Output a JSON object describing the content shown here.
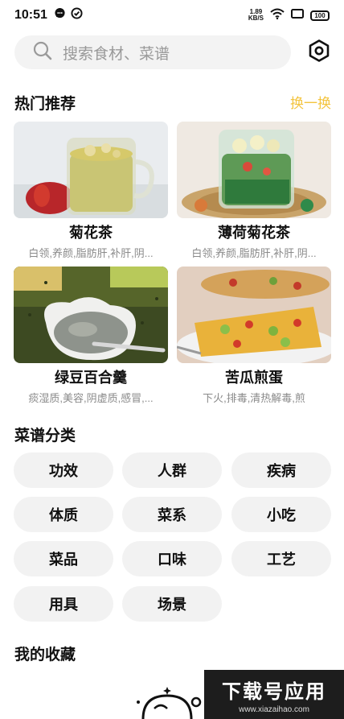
{
  "status_bar": {
    "time": "10:51",
    "net_speed_value": "1.89",
    "net_speed_unit": "KB/S",
    "battery": "100"
  },
  "search": {
    "placeholder": "搜索食材、菜谱"
  },
  "hot": {
    "title": "热门推荐",
    "refresh_label": "换一换",
    "items": [
      {
        "name": "菊花茶",
        "tags": "白领,养颜,脂肪肝,补肝,阴..."
      },
      {
        "name": "薄荷菊花茶",
        "tags": "白领,养颜,脂肪肝,补肝,阴..."
      },
      {
        "name": "绿豆百合羹",
        "tags": "痰湿质,美容,阴虚质,感冒,..."
      },
      {
        "name": "苦瓜煎蛋",
        "tags": "下火,排毒,清热解毒,煎"
      }
    ]
  },
  "categories": {
    "title": "菜谱分类",
    "items": [
      "功效",
      "人群",
      "疾病",
      "体质",
      "菜系",
      "小吃",
      "菜品",
      "口味",
      "工艺",
      "用具",
      "场景"
    ]
  },
  "favorites": {
    "title": "我的收藏"
  },
  "watermark": {
    "main": "下载号应用",
    "url": "www.xiazaihao.com"
  },
  "colors": {
    "accent": "#f3c43e",
    "chip_bg": "#f2f2f2",
    "search_bg": "#f3f3f3",
    "tag_text": "#8a8a8a"
  }
}
